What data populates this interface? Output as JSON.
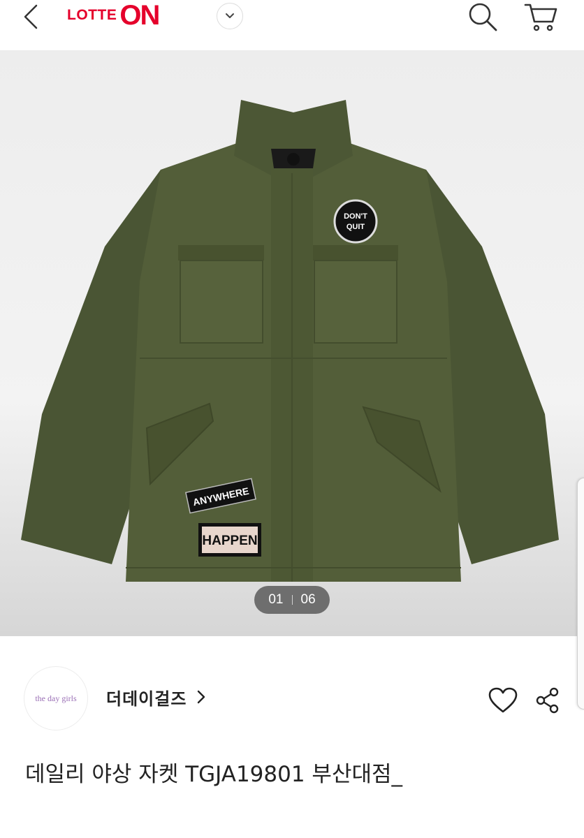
{
  "header": {
    "logo_part1": "LOTTE",
    "logo_part2": "ON",
    "brand_color": "#e5002b"
  },
  "gallery": {
    "patch_top": "DON'T\nQUIT",
    "patch_anywhere": "ANYWHERE",
    "patch_happen": "HAPPEN",
    "current_page": "01",
    "total_pages": "06",
    "jacket_color": "#4f5a36"
  },
  "seller": {
    "logo_text": "the day girls",
    "name": "더데이걸즈"
  },
  "product": {
    "title": "데일리 야상 자켓 TGJA19801 부산대점_"
  }
}
